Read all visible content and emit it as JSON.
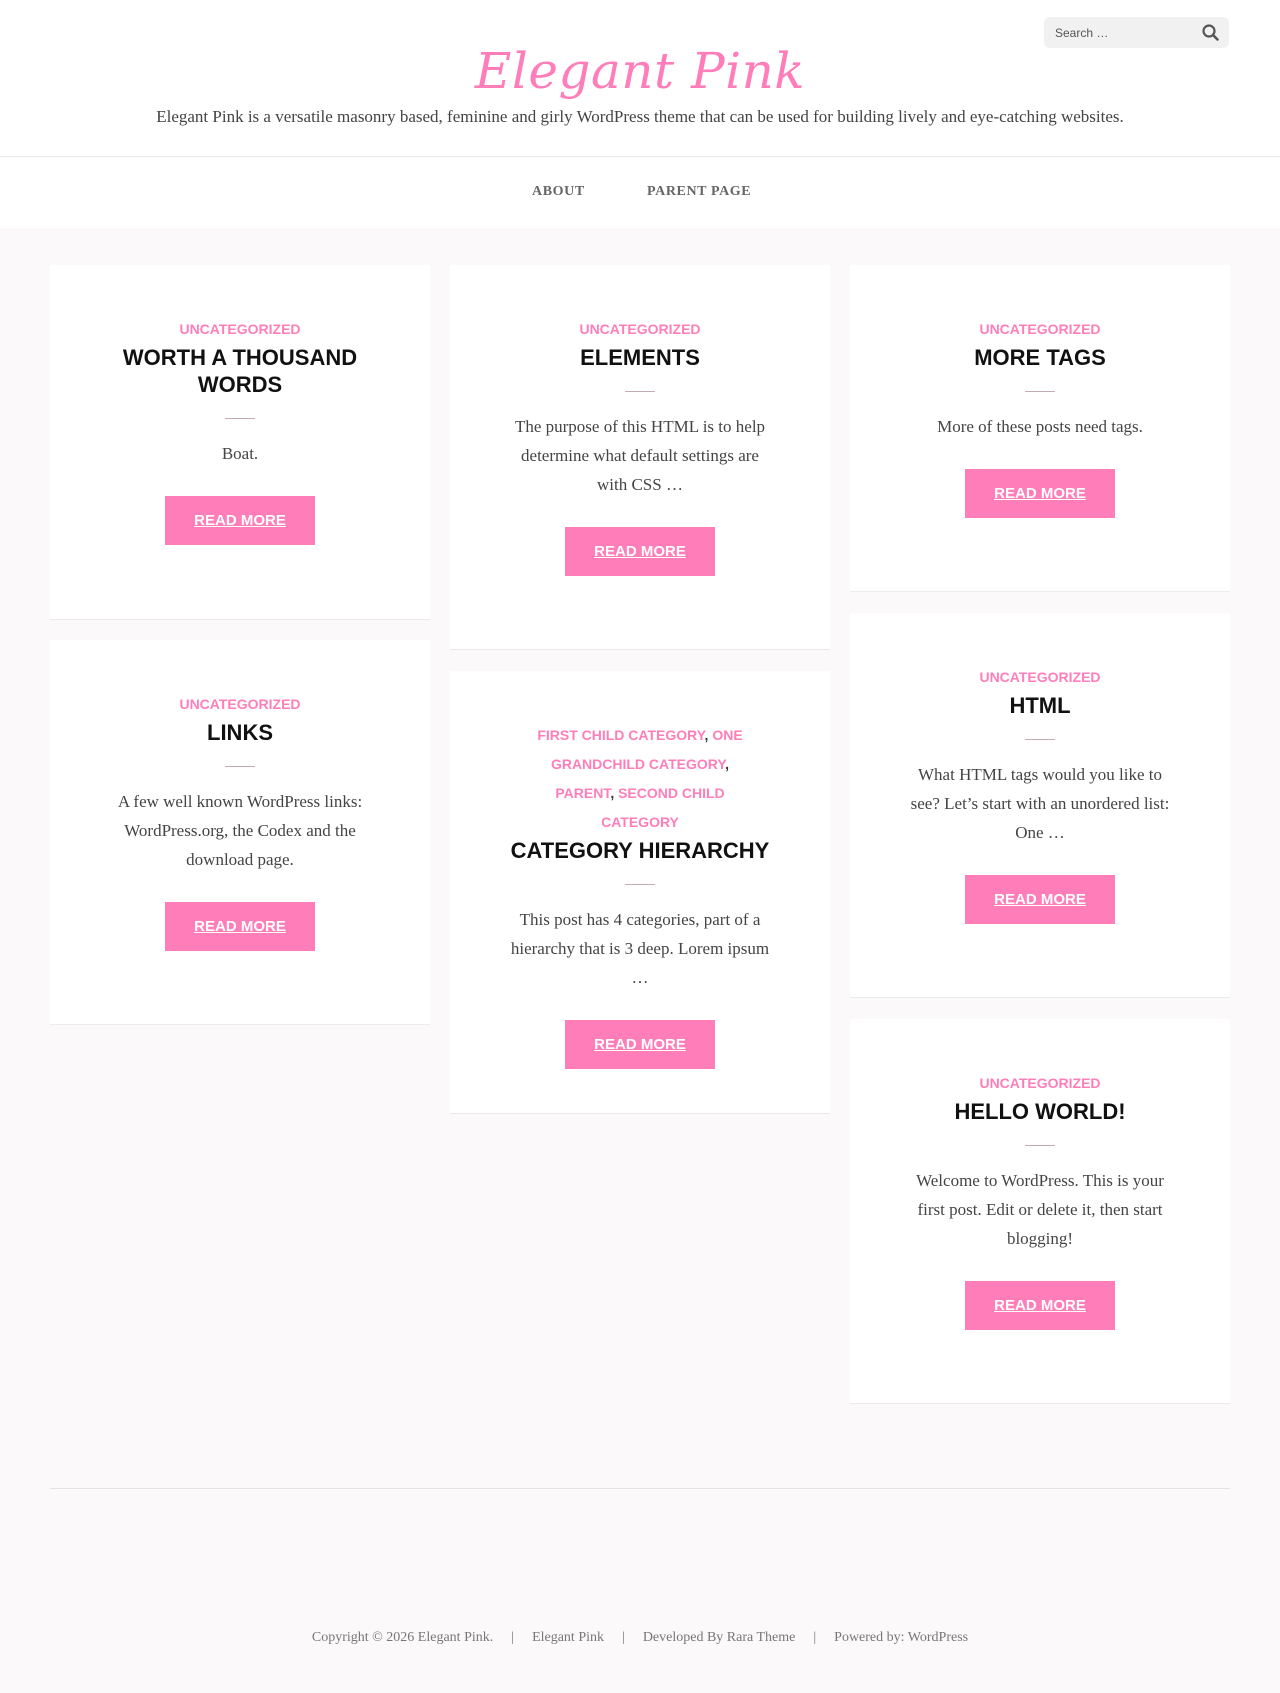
{
  "search": {
    "placeholder": "Search …"
  },
  "header": {
    "title": "Elegant Pink",
    "description": "Elegant Pink is a versatile masonry based, feminine and girly WordPress theme that can be used for building lively and eye-catching websites."
  },
  "nav": {
    "items": [
      "ABOUT",
      "PARENT PAGE"
    ]
  },
  "posts": [
    {
      "categories": [
        "UNCATEGORIZED"
      ],
      "title": "WORTH A THOUSAND WORDS",
      "excerpt": "Boat.",
      "button": "READ MORE"
    },
    {
      "categories": [
        "UNCATEGORIZED"
      ],
      "title": "ELEMENTS",
      "excerpt": "The purpose of this HTML is to help determine what default settings are with CSS …",
      "button": "READ MORE"
    },
    {
      "categories": [
        "UNCATEGORIZED"
      ],
      "title": "MORE TAGS",
      "excerpt": "More of these posts need tags.",
      "button": "READ MORE"
    },
    {
      "categories": [
        "UNCATEGORIZED"
      ],
      "title": "LINKS",
      "excerpt": "A few well known WordPress links: WordPress.org, the Codex and the download page.",
      "button": "READ MORE"
    },
    {
      "categories": [
        "FIRST CHILD CATEGORY",
        "ONE GRANDCHILD CATEGORY",
        "PARENT",
        "SECOND CHILD CATEGORY"
      ],
      "title": "CATEGORY HIERARCHY",
      "excerpt": "This post has 4 categories, part of a hierarchy that is 3 deep. Lorem ipsum …",
      "button": "READ MORE"
    },
    {
      "categories": [
        "UNCATEGORIZED"
      ],
      "title": "HTML",
      "excerpt": "What HTML tags would you like to see? Let’s start with an unordered list: One …",
      "button": "READ MORE"
    },
    {
      "categories": [
        "UNCATEGORIZED"
      ],
      "title": "HELLO WORLD!",
      "excerpt": "Welcome to WordPress. This is your first post. Edit or delete it, then start blogging!",
      "button": "READ MORE"
    }
  ],
  "footer": {
    "copyright": "Copyright © 2026 Elegant Pink.",
    "theme_name": "Elegant Pink",
    "developed_by": "Developed By Rara Theme",
    "powered_by": "Powered by: WordPress",
    "separator": "|"
  },
  "colors": {
    "accent": "#ff7eb9",
    "background": "#fbf9f9",
    "card": "#ffffff"
  }
}
